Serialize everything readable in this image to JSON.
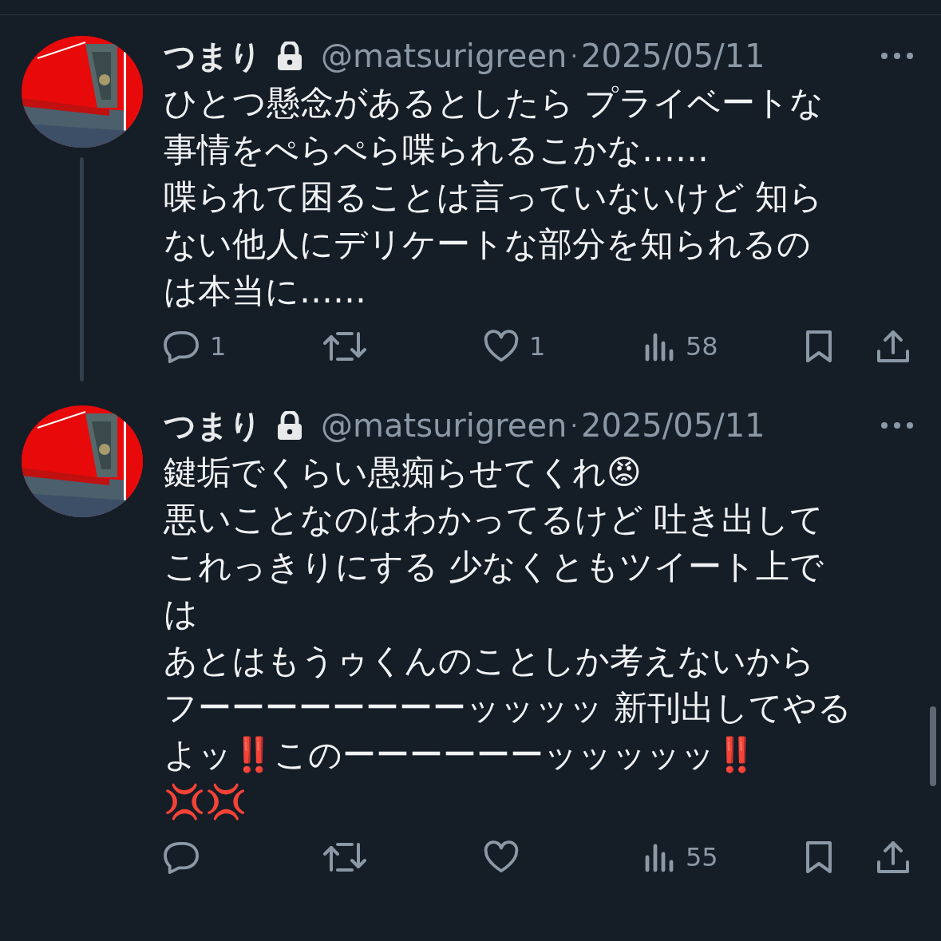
{
  "posts": [
    {
      "name": "つまり",
      "handle": "@matsurigreen",
      "separator": "·",
      "date": "2025/05/11",
      "thread_continues": true,
      "lines": [
        "ひとつ懸念があるとしたら プライベートな",
        "事情をぺらぺら喋られるこかな……",
        "喋られて困ることは言っていないけど 知ら",
        "ない他人にデリケートな部分を知られるの",
        "は本当に……"
      ],
      "actions": [
        {
          "kind": "reply",
          "count": "1"
        },
        {
          "kind": "retweet"
        },
        {
          "kind": "like",
          "count": "1"
        },
        {
          "kind": "views",
          "count": "58"
        },
        {
          "kind": "bookmark"
        },
        {
          "kind": "share"
        }
      ]
    },
    {
      "name": "つまり",
      "handle": "@matsurigreen",
      "separator": "·",
      "date": "2025/05/11",
      "thread_continues": false,
      "lines": [
        "鍵垢でくらい愚痴らせてくれ😡",
        "悪いことなのはわかってるけど 吐き出して",
        "これっきりにする 少なくともツイート上で",
        "は",
        "あとはもうゥくんのことしか考えないから",
        "フーーーーーーーーッッッッ 新刊出してやる",
        "よッ‼️このーーーーーーッッッッッ‼️",
        "💢💢"
      ],
      "actions": [
        {
          "kind": "reply"
        },
        {
          "kind": "retweet"
        },
        {
          "kind": "like"
        },
        {
          "kind": "views",
          "count": "55"
        },
        {
          "kind": "bookmark"
        },
        {
          "kind": "share"
        }
      ]
    }
  ]
}
